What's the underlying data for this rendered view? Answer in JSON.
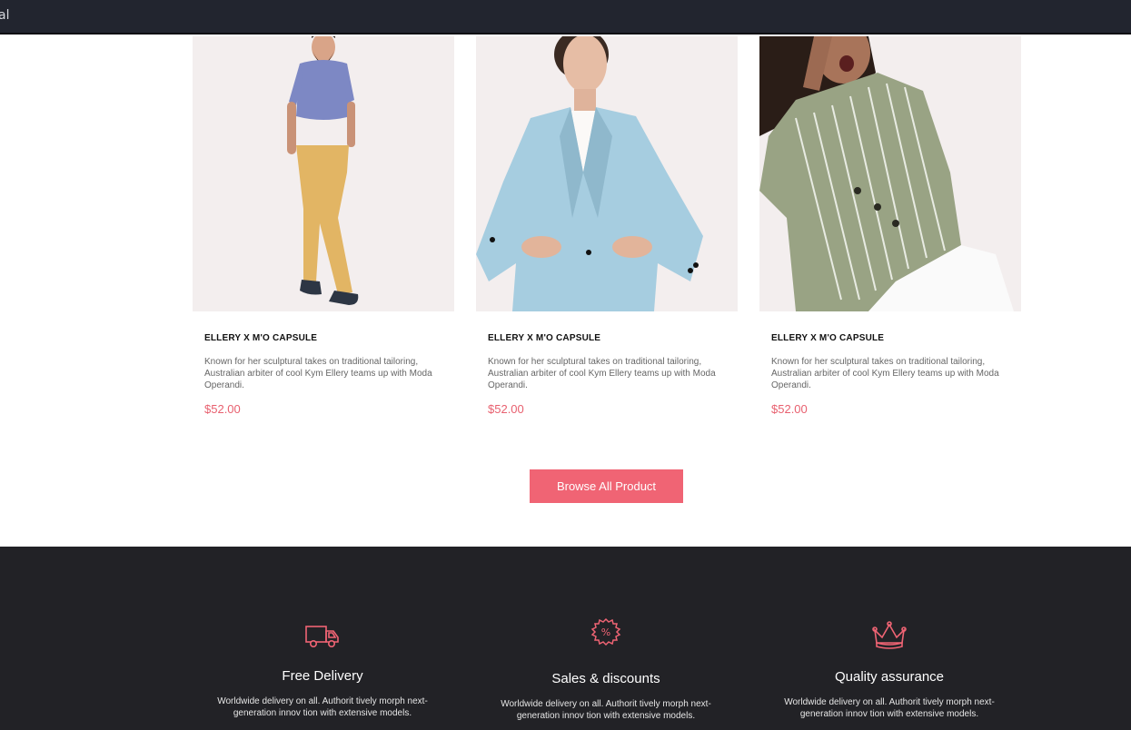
{
  "topbar": {
    "text": "al"
  },
  "products": [
    {
      "title": "ELLERY X M'O CAPSULE",
      "description": "Known for her sculptural takes on traditional tailoring, Australian arbiter of cool Kym Ellery teams up with Moda Operandi.",
      "price": "$52.00"
    },
    {
      "title": "ELLERY X M'O CAPSULE",
      "description": "Known for her sculptural takes on traditional tailoring, Australian arbiter of cool Kym Ellery teams up with Moda Operandi.",
      "price": "$52.00"
    },
    {
      "title": "ELLERY X M'O CAPSULE",
      "description": "Known for her sculptural takes on traditional tailoring, Australian arbiter of cool Kym Ellery teams up with Moda Operandi.",
      "price": "$52.00"
    }
  ],
  "browse_button": {
    "label": "Browse All Product"
  },
  "features": [
    {
      "icon": "truck-icon",
      "title": "Free Delivery",
      "text": "Worldwide delivery on all. Authorit tively morph next-generation innov tion with extensive models."
    },
    {
      "icon": "discount-badge-icon",
      "title": "Sales & discounts",
      "text": "Worldwide delivery on all. Authorit tively morph next-generation innov tion with extensive models."
    },
    {
      "icon": "crown-icon",
      "title": "Quality assurance",
      "text": "Worldwide delivery on all. Authorit tively morph next-generation innov tion with extensive models."
    }
  ],
  "colors": {
    "accent": "#f06474",
    "price": "#e8606f",
    "footer_bg": "#222226",
    "topbar_bg": "#22252f"
  }
}
